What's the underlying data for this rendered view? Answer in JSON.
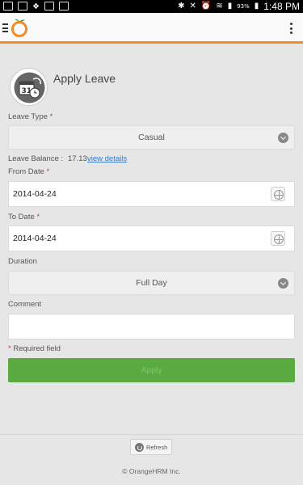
{
  "status_bar": {
    "battery": "93%",
    "time": "1:48 PM",
    "left_icons": [
      "gallery-icon",
      "image-icon",
      "dropbox-icon",
      "email-icon",
      "checkbox-icon"
    ],
    "right_icons": [
      "bluetooth-icon",
      "mute-icon",
      "alarm-icon",
      "wifi-icon",
      "signal-icon",
      "battery-icon"
    ]
  },
  "appbar": {
    "accent_color": "#f28c28"
  },
  "page": {
    "title": "Apply Leave"
  },
  "form": {
    "leave_type": {
      "label": "Leave Type",
      "required_mark": "*",
      "value": "Casual"
    },
    "leave_balance": {
      "label": "Leave Balance :",
      "value": "17.13",
      "link": "view details"
    },
    "from_date": {
      "label": "From Date",
      "required_mark": "*",
      "value": "2014-04-24"
    },
    "to_date": {
      "label": "To Date",
      "required_mark": "*",
      "value": "2014-04-24"
    },
    "duration": {
      "label": "Duration",
      "value": "Full Day"
    },
    "comment": {
      "label": "Comment",
      "value": ""
    },
    "required_note": {
      "mark": "*",
      "text": "Required field"
    },
    "apply_label": "Apply",
    "apply_color": "#5aaa42"
  },
  "footer": {
    "refresh_label": "Refresh",
    "copyright": "© OrangeHRM Inc."
  }
}
